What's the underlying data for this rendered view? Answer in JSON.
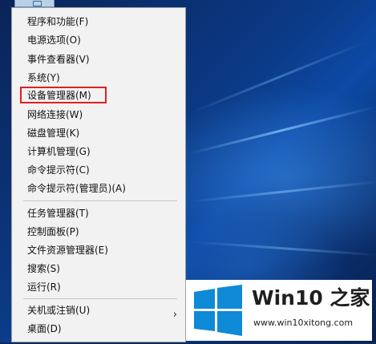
{
  "context_menu": {
    "items": [
      {
        "label": "程序和功能(F)"
      },
      {
        "label": "电源选项(O)"
      },
      {
        "label": "事件查看器(V)"
      },
      {
        "label": "系统(Y)"
      },
      {
        "label": "设备管理器(M)"
      },
      {
        "label": "网络连接(W)"
      },
      {
        "label": "磁盘管理(K)"
      },
      {
        "label": "计算机管理(G)"
      },
      {
        "label": "命令提示符(C)"
      },
      {
        "label": "命令提示符(管理员)(A)"
      },
      {
        "label": "任务管理器(T)"
      },
      {
        "label": "控制面板(P)"
      },
      {
        "label": "文件资源管理器(E)"
      },
      {
        "label": "搜索(S)"
      },
      {
        "label": "运行(R)"
      },
      {
        "label": "关机或注销(U)"
      },
      {
        "label": "桌面(D)"
      }
    ],
    "submenu_arrow": "›",
    "highlighted_item": "设备管理器(M)",
    "highlight_color": "#e02020"
  },
  "watermark": {
    "title": "Win10 之家",
    "subtitle": "www.win10xitong.com",
    "icon": "windows-logo-icon",
    "icon_color": "#0f8ad6"
  },
  "colors": {
    "menu_background": "#f2f2f2",
    "desktop_background": "#0b3a86"
  }
}
